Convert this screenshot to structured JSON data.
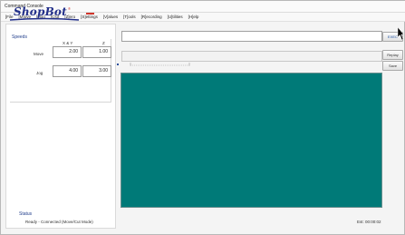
{
  "window": {
    "title": "Command Console"
  },
  "menu": [
    "[File",
    "[M]ove",
    "[J]og",
    "[C]ut",
    "[Z]ero",
    "[S]ettings",
    "[V]alues",
    "[T]ools",
    "[R]ecording",
    "[U]tilities",
    "[H]elp"
  ],
  "logo": {
    "text": "ShopBot",
    "tm": "®"
  },
  "speeds": {
    "label": "Speeds",
    "col_xy": "X & Y",
    "col_z": "Z",
    "rows": [
      {
        "label": "Move",
        "xy": "2.00",
        "z": "1.00"
      },
      {
        "label": "Jog",
        "xy": "4.00",
        "z": "3.00"
      }
    ]
  },
  "command": {
    "value": "",
    "button_label": "EXEC"
  },
  "prompt": {
    "value": "",
    "buttons": [
      "Replay",
      "Save"
    ]
  },
  "status": {
    "label": "Status",
    "text": "Ready - Connected (Move/Cut Mode)",
    "elapsed": "Est: 00:00:02"
  },
  "colors": {
    "preview": "#007a78",
    "logo_blue": "#23308a",
    "accent": "#d0352b"
  },
  "icons": [
    "arrow-cursor-icon",
    "swoosh-icon"
  ]
}
